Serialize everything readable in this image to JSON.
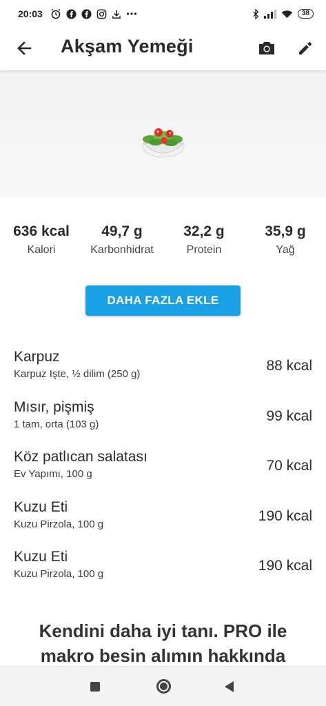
{
  "status_bar": {
    "time": "20:03",
    "battery": "38",
    "left_icons": [
      "alarm-icon",
      "facebook-icon",
      "facebook-icon",
      "instagram-icon",
      "download-icon",
      "more-dots-icon"
    ],
    "right_icons": [
      "bluetooth-icon",
      "signal-icon",
      "wifi-icon",
      "battery-icon"
    ]
  },
  "app_bar": {
    "title": "Akşam Yemeği",
    "icons": [
      "back-arrow-icon",
      "camera-icon",
      "pencil-icon"
    ]
  },
  "hero": {
    "icon": "salad-icon"
  },
  "macros": [
    {
      "value": "636 kcal",
      "label": "Kalori"
    },
    {
      "value": "49,7 g",
      "label": "Karbonhidrat"
    },
    {
      "value": "32,2 g",
      "label": "Protein"
    },
    {
      "value": "35,9 g",
      "label": "Yağ"
    }
  ],
  "actions": {
    "add_more_label": "DAHA FAZLA EKLE"
  },
  "foods": [
    {
      "name": "Karpuz",
      "portion": "Karpuz Işte, ½ dilim (250 g)",
      "kcal": "88 kcal"
    },
    {
      "name": "Mısır, pişmiş",
      "portion": "1 tam, orta (103 g)",
      "kcal": "99 kcal"
    },
    {
      "name": "Köz patlıcan salatası",
      "portion": "Ev Yapımı, 100 g",
      "kcal": "70 kcal"
    },
    {
      "name": "Kuzu Eti",
      "portion": "Kuzu Pirzola, 100 g",
      "kcal": "190 kcal"
    },
    {
      "name": "Kuzu Eti",
      "portion": "Kuzu Pirzola, 100 g",
      "kcal": "190 kcal"
    }
  ],
  "promo": {
    "line1": "Kendini daha iyi tanı. PRO ile",
    "line2": "makro besin alımın hakkında"
  },
  "colors": {
    "accent": "#1aa1e5",
    "text": "#2b2b2b",
    "hero_bg": "#f3f3f3"
  }
}
